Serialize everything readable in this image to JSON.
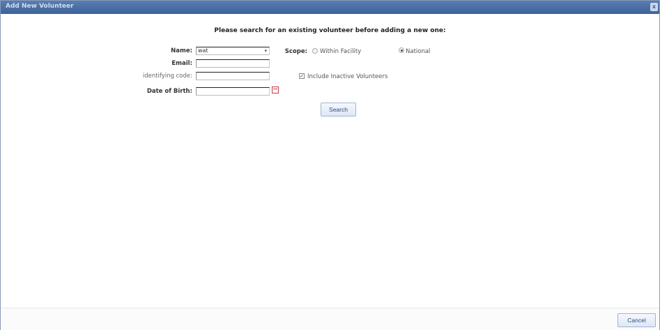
{
  "window": {
    "title": "Add New Volunteer",
    "close_glyph": "x"
  },
  "search": {
    "heading": "Please search for an existing volunteer before adding a new one:",
    "name_label": "Name:",
    "name_value": "wat",
    "email_label": "Email:",
    "email_value": "",
    "code_label": "identifying code:",
    "code_value": "",
    "dob_label": "Date of Birth:",
    "dob_value": "",
    "scope_label": "Scope:",
    "scope_options": [
      {
        "label": "Within Facility",
        "selected": false
      },
      {
        "label": "National",
        "selected": true
      }
    ],
    "include_inactive_label": "Include Inactive Volunteers",
    "include_inactive_checked": true,
    "search_button": "Search"
  },
  "footer": {
    "cancel_button": "Cancel"
  },
  "icons": {
    "dropdown": "chevron-down-icon",
    "calendar": "calendar-icon",
    "close": "close-icon"
  }
}
